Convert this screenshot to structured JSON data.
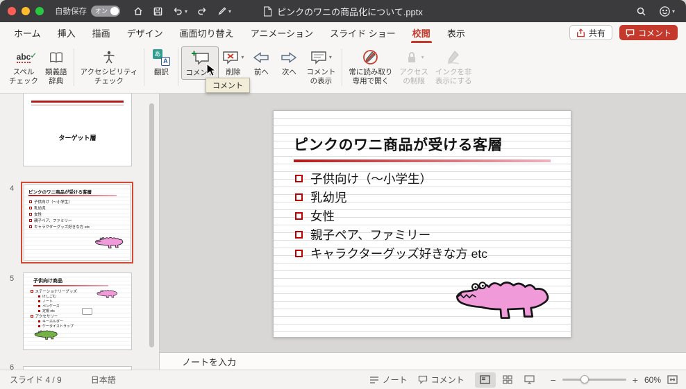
{
  "titlebar": {
    "autosave_label": "自動保存",
    "autosave_state": "オン",
    "doc_title": "ピンクのワニの商品化について.pptx"
  },
  "tabbar": {
    "tabs": [
      {
        "label": "ホーム"
      },
      {
        "label": "挿入"
      },
      {
        "label": "描画"
      },
      {
        "label": "デザイン"
      },
      {
        "label": "画面切り替え"
      },
      {
        "label": "アニメーション"
      },
      {
        "label": "スライド ショー"
      },
      {
        "label": "校閲"
      },
      {
        "label": "表示"
      }
    ],
    "share_label": "共有",
    "comments_label": "コメント"
  },
  "ribbon": {
    "buttons": [
      {
        "label": "スペル\nチェック"
      },
      {
        "label": "類義語\n辞典"
      },
      {
        "label": "アクセシビリティ\nチェック"
      },
      {
        "label": "翻訳"
      },
      {
        "label": "コメント"
      },
      {
        "label": "削除"
      },
      {
        "label": "前へ"
      },
      {
        "label": "次へ"
      },
      {
        "label": "コメント\nの表示"
      },
      {
        "label": "常に読み取り\n専用で開く"
      },
      {
        "label": "アクセス\nの制限"
      },
      {
        "label": "インクを非\n表示にする"
      }
    ],
    "tooltip": "コメント"
  },
  "icons": {
    "chevron_down": "▾",
    "check": "✓",
    "spell_abc": "abc",
    "translate_src": "あ",
    "translate_dst": "A",
    "zoom_out": "−",
    "zoom_in": "+"
  },
  "sidebar": {
    "thumb3": {
      "title": "ターゲット層"
    },
    "thumb4": {
      "number": "4",
      "title": "ピンクのワニ商品が受ける客層",
      "bullets": [
        "子供向け（〜小学生）",
        "乳幼児",
        "女性",
        "親子ペア、ファミリー",
        "キャラクターグッズ好きな方 etc"
      ]
    },
    "thumb5": {
      "number": "5",
      "title": "子供向け商品",
      "items": [
        {
          "text": "ステーショナリーグッズ"
        },
        {
          "text": "けしごむ"
        },
        {
          "text": "ノート"
        },
        {
          "text": "ペンケース"
        },
        {
          "text": "定規 etc"
        },
        {
          "text": "アクセサリー"
        },
        {
          "text": "キーホルダー"
        },
        {
          "text": "ケータイストラップ"
        }
      ]
    },
    "thumb6": {
      "number": "6"
    }
  },
  "slide": {
    "title": "ピンクのワニ商品が受ける客層",
    "bullets": [
      "子供向け（〜小学生）",
      "乳幼児",
      "女性",
      "親子ペア、ファミリー",
      "キャラクターグッズ好きな方 etc"
    ]
  },
  "notes": {
    "placeholder": "ノートを入力"
  },
  "statusbar": {
    "slide_info": "スライド 4 / 9",
    "language": "日本語",
    "notes_label": "ノート",
    "comments_label": "コメント",
    "zoom_level": "60%"
  },
  "colors": {
    "accent_red": "#c5392c",
    "croc_pink": "#f09ad9",
    "croc_green": "#74b247"
  }
}
